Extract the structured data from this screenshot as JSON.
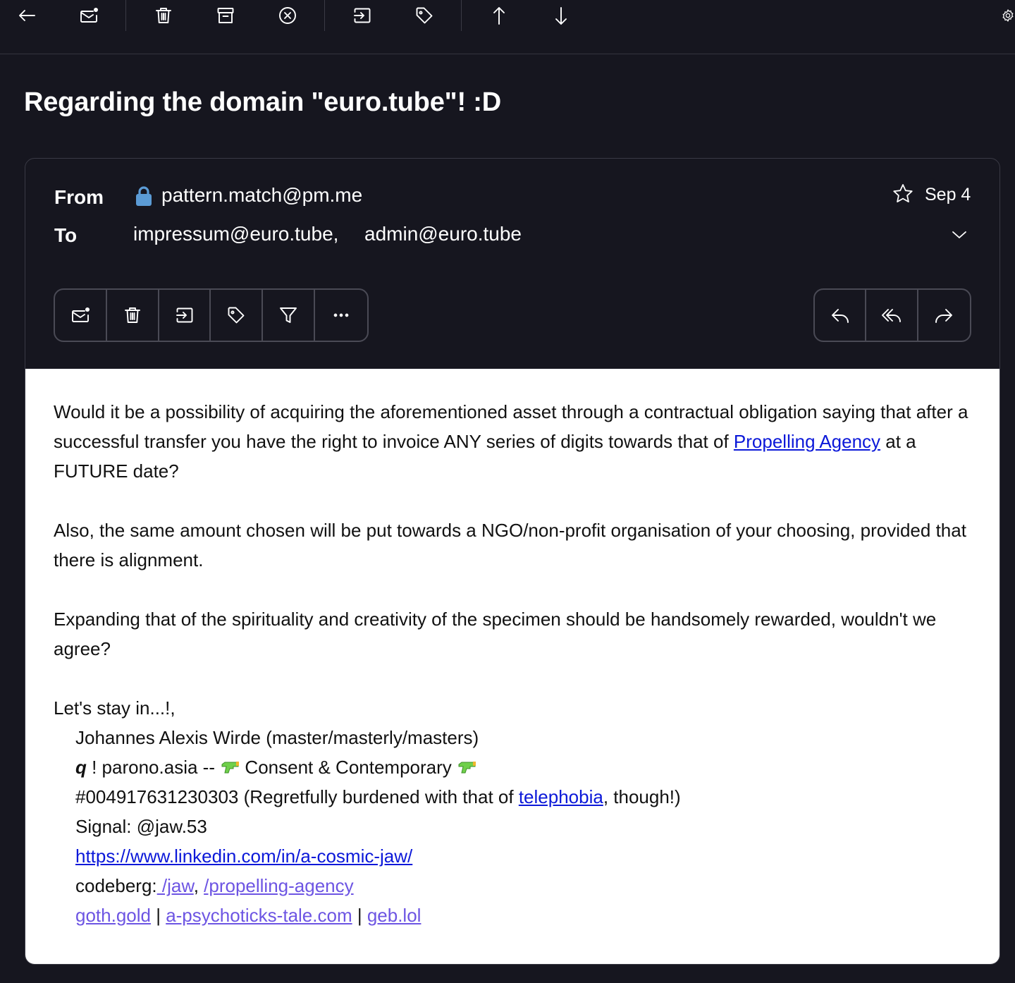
{
  "subject": "Regarding the domain \"euro.tube\"! :D",
  "message": {
    "from_label": "From",
    "to_label": "To",
    "from_address": "pattern.match@pm.me",
    "to_addresses": [
      "impressum@euro.tube,",
      "admin@euro.tube"
    ],
    "date": "Sep 4"
  },
  "body": {
    "p1_before": "Would it be a possibility of acquiring the aforementioned asset through a contractual obligation saying that after a successful transfer you have the right to invoice ANY series of digits towards that of ",
    "p1_link": "Propelling Agency",
    "p1_after": " at a FUTURE date?",
    "p2": "Also, the same amount chosen will be put towards a NGO/non-profit organisation of your choosing, provided that there is alignment.",
    "p3": "Expanding that of the spirituality and creativity of the specimen should be handsomely rewarded, wouldn't we agree?",
    "closing": "Let's stay in...!,",
    "signature": {
      "name": "Johannes Alexis Wirde (master/masterly/masters)",
      "q_mark": "q",
      "line2_a": " ! parono.asia -- ",
      "line2_b": " Consent & Contemporary ",
      "phone_before": "#004917631230303 (Regretfully burdened with that of ",
      "phone_link": "telephobia",
      "phone_after": ", though!)",
      "signal": "Signal: @jaw.53",
      "linkedin": "https://www.linkedin.com/in/a-cosmic-jaw/",
      "codeberg_label": "codeberg:",
      "codeberg_link1": " /jaw",
      "codeberg_sep": ", ",
      "codeberg_link2": "/propelling-agency",
      "site1": "goth.gold",
      "site_sep": " | ",
      "site2": "a-psychoticks-tale.com",
      "site3": "geb.lol"
    }
  },
  "icons": {
    "toolbar": [
      "back-arrow-icon",
      "mark-unread-icon",
      "trash-icon",
      "archive-icon",
      "spam-icon",
      "move-to-folder-icon",
      "label-icon",
      "previous-message-icon",
      "next-message-icon",
      "settings-icon"
    ],
    "actions": [
      "mark-unread-icon",
      "trash-icon",
      "move-to-folder-icon",
      "label-icon",
      "filter-icon",
      "more-icon"
    ],
    "reply": [
      "reply-icon",
      "reply-all-icon",
      "forward-icon"
    ]
  },
  "colors": {
    "background": "#16161f",
    "link": "#0b18d9",
    "visited_link": "#6d55e3",
    "lock": "#5b9bd5"
  }
}
